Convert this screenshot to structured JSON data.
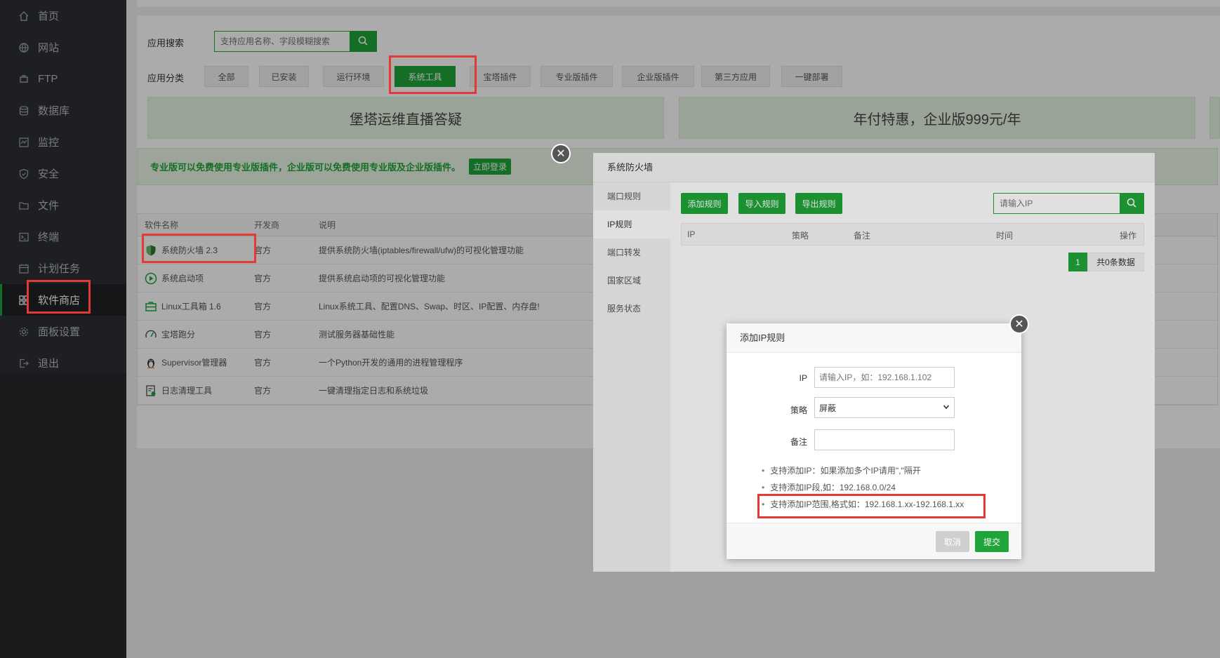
{
  "sidebar": {
    "items": [
      {
        "label": "首页",
        "icon": "home-icon"
      },
      {
        "label": "网站",
        "icon": "globe-icon"
      },
      {
        "label": "FTP",
        "icon": "ftp-icon"
      },
      {
        "label": "数据库",
        "icon": "database-icon"
      },
      {
        "label": "监控",
        "icon": "monitor-icon"
      },
      {
        "label": "安全",
        "icon": "shield-icon"
      },
      {
        "label": "文件",
        "icon": "folder-icon"
      },
      {
        "label": "终端",
        "icon": "terminal-icon"
      },
      {
        "label": "计划任务",
        "icon": "calendar-icon"
      },
      {
        "label": "软件商店",
        "icon": "grid-icon"
      },
      {
        "label": "面板设置",
        "icon": "gear-icon"
      },
      {
        "label": "退出",
        "icon": "logout-icon"
      }
    ],
    "active_index": 9
  },
  "store": {
    "search_label": "应用搜索",
    "search_placeholder": "支持应用名称、字段模糊搜索",
    "category_label": "应用分类",
    "categories": [
      "全部",
      "已安装",
      "运行环境",
      "系统工具",
      "宝塔插件",
      "专业版插件",
      "企业版插件",
      "第三方应用",
      "一键部署"
    ],
    "active_category": "系统工具",
    "banners": [
      "堡塔运维直播答疑",
      "年付特惠，企业版999元/年"
    ],
    "notice": "专业版可以免费使用专业版插件，企业版可以免费使用专业版及企业版插件。",
    "notice_button": "立即登录",
    "table": {
      "headers": [
        "软件名称",
        "开发商",
        "说明"
      ],
      "rows": [
        {
          "name": "系统防火墙 2.3",
          "dev": "官方",
          "desc": "提供系统防火墙(iptables/firewall/ufw)的可视化管理功能",
          "icon": "firewall-shield-icon"
        },
        {
          "name": "系统启动项",
          "dev": "官方",
          "desc": "提供系统启动项的可视化管理功能",
          "icon": "play-circle-icon"
        },
        {
          "name": "Linux工具箱 1.6",
          "dev": "官方",
          "desc": "Linux系统工具、配置DNS、Swap、时区、IP配置、内存盘!",
          "icon": "toolbox-icon"
        },
        {
          "name": "宝塔跑分",
          "dev": "官方",
          "desc": "测试服务器基础性能",
          "icon": "gauge-icon"
        },
        {
          "name": "Supervisor管理器",
          "dev": "官方",
          "desc": "一个Python开发的通用的进程管理程序",
          "icon": "linux-penguin-icon"
        },
        {
          "name": "日志清理工具",
          "dev": "官方",
          "desc": "一键清理指定日志和系统垃圾",
          "icon": "log-clean-icon"
        }
      ]
    }
  },
  "firewall": {
    "title": "系统防火墙",
    "nav": [
      "端口规则",
      "IP规则",
      "端口转发",
      "国家区域",
      "服务状态"
    ],
    "active_nav": "IP规则",
    "buttons": [
      "添加规则",
      "导入规则",
      "导出规则"
    ],
    "search_placeholder": "请输入IP",
    "columns": [
      "IP",
      "策略",
      "备注",
      "时间",
      "操作"
    ],
    "page": "1",
    "total": "共0条数据"
  },
  "add_ip": {
    "title": "添加IP规则",
    "ip_label": "IP",
    "ip_placeholder": "请输入IP，如：192.168.1.102",
    "policy_label": "策略",
    "policy_value": "屏蔽",
    "note_label": "备注",
    "note_value": "",
    "tips": [
      "支持添加IP：如果添加多个IP请用\",\"隔开",
      "支持添加IP段,如：192.168.0.0/24",
      "支持添加IP范围,格式如：192.168.1.xx-192.168.1.xx"
    ],
    "cancel": "取消",
    "submit": "提交"
  },
  "colors": {
    "accent": "#20a53a",
    "annotation": "#e53935",
    "sidebar_bg": "#2c2f33"
  }
}
